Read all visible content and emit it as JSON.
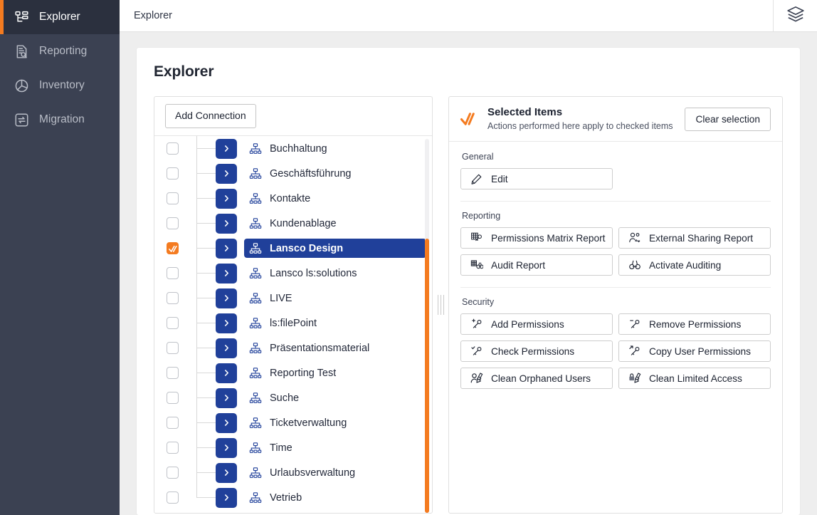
{
  "sidebar": {
    "items": [
      {
        "label": "Explorer",
        "icon": "sitemap-icon",
        "active": true
      },
      {
        "label": "Reporting",
        "icon": "report-search-icon",
        "active": false
      },
      {
        "label": "Inventory",
        "icon": "pie-chart-icon",
        "active": false
      },
      {
        "label": "Migration",
        "icon": "transfer-icon",
        "active": false
      }
    ]
  },
  "topbar": {
    "title": "Explorer",
    "right_icon": "layers-icon"
  },
  "page": {
    "title": "Explorer"
  },
  "tree": {
    "add_connection_label": "Add Connection",
    "rows": [
      {
        "label": "Buchhaltung",
        "checked": false,
        "selected": false
      },
      {
        "label": "Geschäftsführung",
        "checked": false,
        "selected": false
      },
      {
        "label": "Kontakte",
        "checked": false,
        "selected": false
      },
      {
        "label": "Kundenablage",
        "checked": false,
        "selected": false
      },
      {
        "label": "Lansco Design",
        "checked": true,
        "selected": true
      },
      {
        "label": "Lansco ls:solutions",
        "checked": false,
        "selected": false
      },
      {
        "label": "LIVE",
        "checked": false,
        "selected": false
      },
      {
        "label": "ls:filePoint",
        "checked": false,
        "selected": false
      },
      {
        "label": "Präsentationsmaterial",
        "checked": false,
        "selected": false
      },
      {
        "label": "Reporting Test",
        "checked": false,
        "selected": false
      },
      {
        "label": "Suche",
        "checked": false,
        "selected": false
      },
      {
        "label": "Ticketverwaltung",
        "checked": false,
        "selected": false
      },
      {
        "label": "Time",
        "checked": false,
        "selected": false
      },
      {
        "label": "Urlaubsverwaltung",
        "checked": false,
        "selected": false
      },
      {
        "label": "Vetrieb",
        "checked": false,
        "selected": false
      }
    ]
  },
  "actions_panel": {
    "header": {
      "icon": "double-check-icon",
      "title": "Selected Items",
      "subtitle": "Actions performed here apply to checked items",
      "clear_label": "Clear selection"
    },
    "sections": [
      {
        "label": "General",
        "buttons": [
          {
            "label": "Edit",
            "icon": "pencil-icon"
          }
        ]
      },
      {
        "label": "Reporting",
        "buttons": [
          {
            "label": "Permissions Matrix Report",
            "icon": "matrix-key-icon"
          },
          {
            "label": "External Sharing Report",
            "icon": "user-share-icon"
          },
          {
            "label": "Audit Report",
            "icon": "matrix-binoculars-icon"
          },
          {
            "label": "Activate Auditing",
            "icon": "binoculars-icon"
          }
        ]
      },
      {
        "label": "Security",
        "buttons": [
          {
            "label": "Add Permissions",
            "icon": "key-plus-icon"
          },
          {
            "label": "Remove Permissions",
            "icon": "key-minus-icon"
          },
          {
            "label": "Check Permissions",
            "icon": "key-check-icon"
          },
          {
            "label": "Copy User Permissions",
            "icon": "key-arrow-icon"
          },
          {
            "label": "Clean Orphaned Users",
            "icon": "user-broom-icon"
          },
          {
            "label": "Clean Limited Access",
            "icon": "lock-broom-icon"
          }
        ]
      }
    ]
  },
  "colors": {
    "sidebar_bg": "#3b4152",
    "sidebar_active_bg": "#2b303e",
    "accent_orange": "#f47b20",
    "accent_blue": "#20409a",
    "page_bg": "#eeeeee",
    "card_bg": "#ffffff"
  }
}
